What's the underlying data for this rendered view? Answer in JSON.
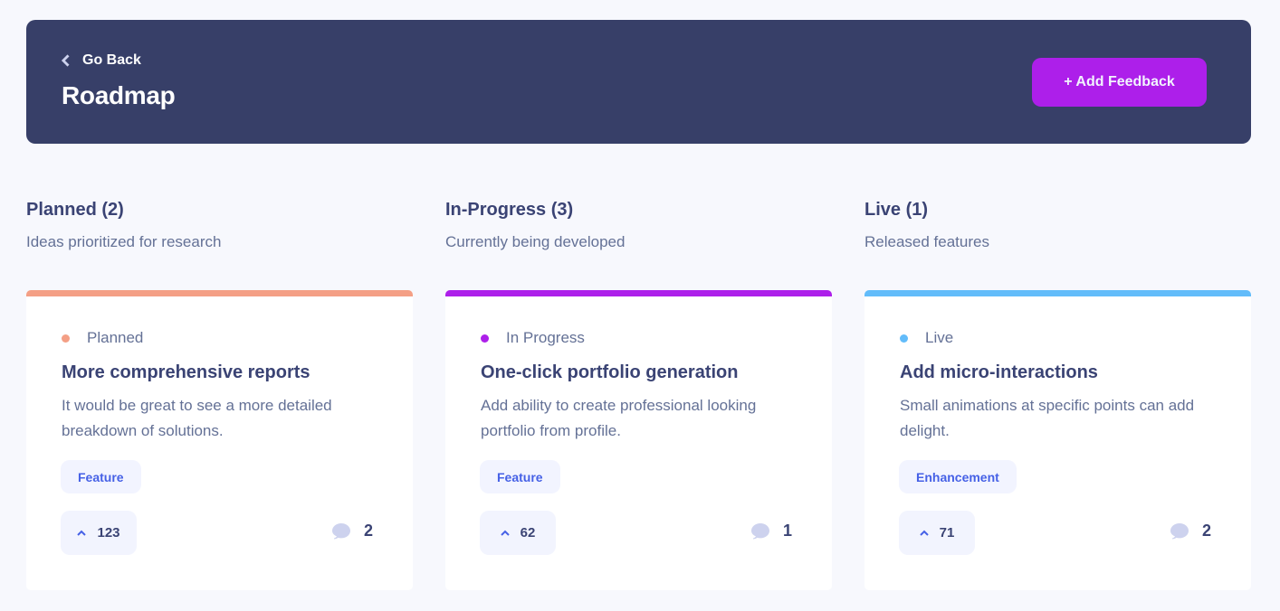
{
  "header": {
    "back_label": "Go Back",
    "back_icon": "chevron-left-icon",
    "title": "Roadmap",
    "add_button_label": "+ Add Feedback"
  },
  "colors": {
    "header_bg": "#373f68",
    "accent": "#ad1fea",
    "planned": "#f49f85",
    "in_progress": "#ad1fea",
    "live": "#62bcfa"
  },
  "columns": [
    {
      "title": "Planned (2)",
      "subtitle": "Ideas prioritized for research",
      "card": {
        "status": "Planned",
        "title": "More comprehensive reports",
        "description": "It would be great to see a more detailed breakdown of solutions.",
        "tag": "Feature",
        "upvotes": "123",
        "comments": "2"
      }
    },
    {
      "title": "In-Progress (3)",
      "subtitle": "Currently being developed",
      "card": {
        "status": "In Progress",
        "title": "One-click portfolio generation",
        "description": "Add ability to create professional looking portfolio from profile.",
        "tag": "Feature",
        "upvotes": "62",
        "comments": "1"
      }
    },
    {
      "title": "Live (1)",
      "subtitle": "Released features",
      "card": {
        "status": "Live",
        "title": "Add micro-interactions",
        "description": "Small animations at specific points can add delight.",
        "tag": "Enhancement",
        "upvotes": "71",
        "comments": "2"
      }
    }
  ]
}
